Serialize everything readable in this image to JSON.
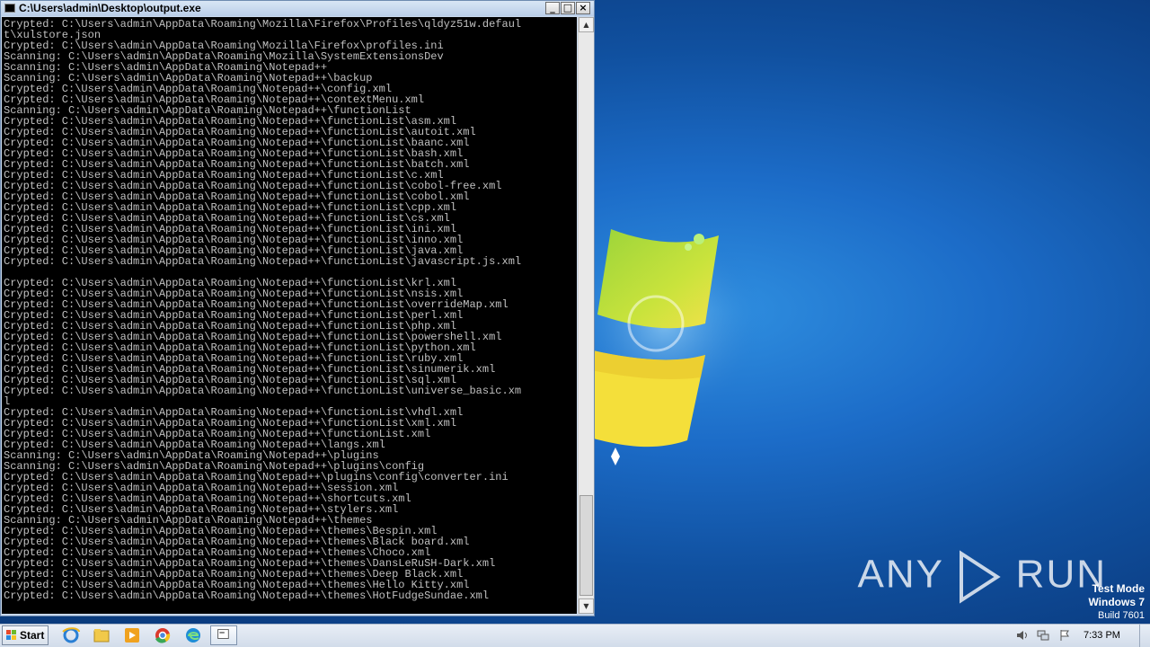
{
  "console": {
    "title": "C:\\Users\\admin\\Desktop\\output.exe",
    "buttons": {
      "minimize": "_",
      "maximize": "□",
      "close": "×"
    },
    "lines": [
      "Crypted: C:\\Users\\admin\\AppData\\Roaming\\Mozilla\\Firefox\\Profiles\\qldyz51w.defaul",
      "t\\xulstore.json",
      "Crypted: C:\\Users\\admin\\AppData\\Roaming\\Mozilla\\Firefox\\profiles.ini",
      "Scanning: C:\\Users\\admin\\AppData\\Roaming\\Mozilla\\SystemExtensionsDev",
      "Scanning: C:\\Users\\admin\\AppData\\Roaming\\Notepad++",
      "Scanning: C:\\Users\\admin\\AppData\\Roaming\\Notepad++\\backup",
      "Crypted: C:\\Users\\admin\\AppData\\Roaming\\Notepad++\\config.xml",
      "Crypted: C:\\Users\\admin\\AppData\\Roaming\\Notepad++\\contextMenu.xml",
      "Scanning: C:\\Users\\admin\\AppData\\Roaming\\Notepad++\\functionList",
      "Crypted: C:\\Users\\admin\\AppData\\Roaming\\Notepad++\\functionList\\asm.xml",
      "Crypted: C:\\Users\\admin\\AppData\\Roaming\\Notepad++\\functionList\\autoit.xml",
      "Crypted: C:\\Users\\admin\\AppData\\Roaming\\Notepad++\\functionList\\baanc.xml",
      "Crypted: C:\\Users\\admin\\AppData\\Roaming\\Notepad++\\functionList\\bash.xml",
      "Crypted: C:\\Users\\admin\\AppData\\Roaming\\Notepad++\\functionList\\batch.xml",
      "Crypted: C:\\Users\\admin\\AppData\\Roaming\\Notepad++\\functionList\\c.xml",
      "Crypted: C:\\Users\\admin\\AppData\\Roaming\\Notepad++\\functionList\\cobol-free.xml",
      "Crypted: C:\\Users\\admin\\AppData\\Roaming\\Notepad++\\functionList\\cobol.xml",
      "Crypted: C:\\Users\\admin\\AppData\\Roaming\\Notepad++\\functionList\\cpp.xml",
      "Crypted: C:\\Users\\admin\\AppData\\Roaming\\Notepad++\\functionList\\cs.xml",
      "Crypted: C:\\Users\\admin\\AppData\\Roaming\\Notepad++\\functionList\\ini.xml",
      "Crypted: C:\\Users\\admin\\AppData\\Roaming\\Notepad++\\functionList\\inno.xml",
      "Crypted: C:\\Users\\admin\\AppData\\Roaming\\Notepad++\\functionList\\java.xml",
      "Crypted: C:\\Users\\admin\\AppData\\Roaming\\Notepad++\\functionList\\javascript.js.xml",
      "",
      "Crypted: C:\\Users\\admin\\AppData\\Roaming\\Notepad++\\functionList\\krl.xml",
      "Crypted: C:\\Users\\admin\\AppData\\Roaming\\Notepad++\\functionList\\nsis.xml",
      "Crypted: C:\\Users\\admin\\AppData\\Roaming\\Notepad++\\functionList\\overrideMap.xml",
      "Crypted: C:\\Users\\admin\\AppData\\Roaming\\Notepad++\\functionList\\perl.xml",
      "Crypted: C:\\Users\\admin\\AppData\\Roaming\\Notepad++\\functionList\\php.xml",
      "Crypted: C:\\Users\\admin\\AppData\\Roaming\\Notepad++\\functionList\\powershell.xml",
      "Crypted: C:\\Users\\admin\\AppData\\Roaming\\Notepad++\\functionList\\python.xml",
      "Crypted: C:\\Users\\admin\\AppData\\Roaming\\Notepad++\\functionList\\ruby.xml",
      "Crypted: C:\\Users\\admin\\AppData\\Roaming\\Notepad++\\functionList\\sinumerik.xml",
      "Crypted: C:\\Users\\admin\\AppData\\Roaming\\Notepad++\\functionList\\sql.xml",
      "Crypted: C:\\Users\\admin\\AppData\\Roaming\\Notepad++\\functionList\\universe_basic.xm",
      "l",
      "Crypted: C:\\Users\\admin\\AppData\\Roaming\\Notepad++\\functionList\\vhdl.xml",
      "Crypted: C:\\Users\\admin\\AppData\\Roaming\\Notepad++\\functionList\\xml.xml",
      "Crypted: C:\\Users\\admin\\AppData\\Roaming\\Notepad++\\functionList.xml",
      "Crypted: C:\\Users\\admin\\AppData\\Roaming\\Notepad++\\langs.xml",
      "Scanning: C:\\Users\\admin\\AppData\\Roaming\\Notepad++\\plugins",
      "Scanning: C:\\Users\\admin\\AppData\\Roaming\\Notepad++\\plugins\\config",
      "Crypted: C:\\Users\\admin\\AppData\\Roaming\\Notepad++\\plugins\\config\\converter.ini",
      "Crypted: C:\\Users\\admin\\AppData\\Roaming\\Notepad++\\session.xml",
      "Crypted: C:\\Users\\admin\\AppData\\Roaming\\Notepad++\\shortcuts.xml",
      "Crypted: C:\\Users\\admin\\AppData\\Roaming\\Notepad++\\stylers.xml",
      "Scanning: C:\\Users\\admin\\AppData\\Roaming\\Notepad++\\themes",
      "Crypted: C:\\Users\\admin\\AppData\\Roaming\\Notepad++\\themes\\Bespin.xml",
      "Crypted: C:\\Users\\admin\\AppData\\Roaming\\Notepad++\\themes\\Black board.xml",
      "Crypted: C:\\Users\\admin\\AppData\\Roaming\\Notepad++\\themes\\Choco.xml",
      "Crypted: C:\\Users\\admin\\AppData\\Roaming\\Notepad++\\themes\\DansLeRuSH-Dark.xml",
      "Crypted: C:\\Users\\admin\\AppData\\Roaming\\Notepad++\\themes\\Deep Black.xml",
      "Crypted: C:\\Users\\admin\\AppData\\Roaming\\Notepad++\\themes\\Hello Kitty.xml",
      "Crypted: C:\\Users\\admin\\AppData\\Roaming\\Notepad++\\themes\\HotFudgeSundae.xml"
    ]
  },
  "desktop": {
    "watermark_left": "ANY",
    "watermark_right": "RUN",
    "test_mode": {
      "line1": "Test Mode",
      "line2": "Windows 7",
      "line3": "Build 7601"
    }
  },
  "taskbar": {
    "start_label": "Start",
    "pinned": [
      "internet-explorer-icon",
      "file-explorer-icon",
      "media-player-icon",
      "chrome-icon",
      "edge-icon",
      "console-app-icon"
    ],
    "clock": "7:33 PM"
  },
  "colors": {
    "console_bg": "#000000",
    "console_text": "#c0c0c0",
    "desktop_blue": "#1c6cc8"
  }
}
